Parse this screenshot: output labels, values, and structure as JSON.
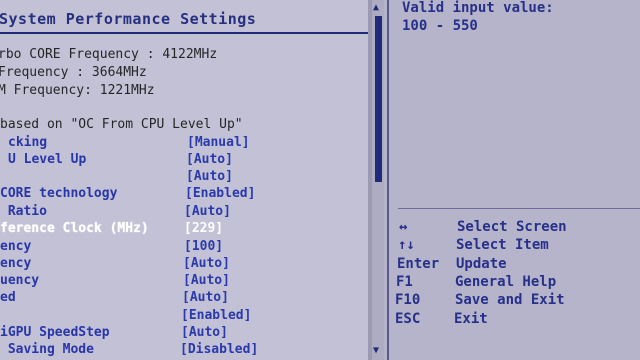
{
  "panel": {
    "title": "System Performance Settings"
  },
  "info_lines": [
    "rbo CORE Frequency : 4122MHz",
    "Frequency : 3664MHz",
    "M Frequency: 1221MHz",
    "based on \"OC From CPU Level Up\""
  ],
  "settings": [
    {
      "label": "cking",
      "value": "[Manual]"
    },
    {
      "label": "U Level Up",
      "value": "[Auto]"
    },
    {
      "label": "",
      "value": "[Auto]"
    },
    {
      "label": "CORE technology",
      "value": "[Enabled]"
    },
    {
      "label": " Ratio",
      "value": "[Auto]"
    },
    {
      "label": "ference Clock (MHz)",
      "value": "[229]"
    },
    {
      "label": "ency",
      "value": "[100]"
    },
    {
      "label": "ency",
      "value": "[Auto]"
    },
    {
      "label": "uency",
      "value": "[Auto]"
    },
    {
      "label": "ed",
      "value": "[Auto]"
    },
    {
      "label": "",
      "value": "[Enabled]"
    },
    {
      "label": "iGPU SpeedStep",
      "value": "[Auto]"
    },
    {
      "label": " Saving Mode",
      "value": "[Disabled]"
    }
  ],
  "help": {
    "line1": "Valid input value:",
    "line2": "100 - 550"
  },
  "keys": [
    {
      "key": "↔",
      "action": "Select Screen"
    },
    {
      "key": "↑↓",
      "action": "Select Item"
    },
    {
      "key": "Enter",
      "action": "Update"
    },
    {
      "key": "F1",
      "action": "General Help"
    },
    {
      "key": "F10",
      "action": "Save and Exit"
    },
    {
      "key": "ESC",
      "action": "Exit"
    }
  ],
  "scroll": {
    "up_icon": "▲",
    "down_icon": "▼"
  }
}
